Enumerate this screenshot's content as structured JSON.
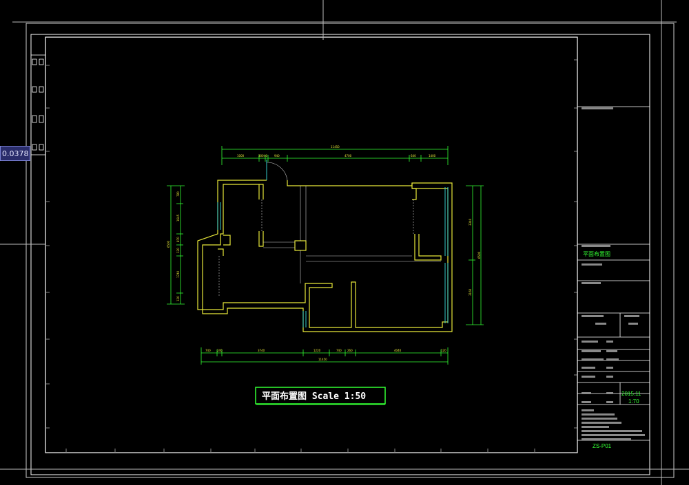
{
  "viewport": {
    "coordinate_readout": "0.0378"
  },
  "drawing": {
    "title_label": "平面布置图 Scale 1:50",
    "dimensions": {
      "top_total": "11450",
      "top_segments": [
        "1000",
        "300",
        "40",
        "940",
        "4700",
        "640",
        "1400"
      ],
      "bottom_total": "11450",
      "bottom_segments": [
        "740",
        "240",
        "3740",
        "1220",
        "740",
        "260",
        "4040",
        "120"
      ],
      "left_total": "6500",
      "left_segments": [
        "780",
        "1645",
        "870",
        "120",
        "1740",
        "120"
      ],
      "right_total": "6500",
      "right_segments": [
        "3340",
        "3160"
      ]
    }
  },
  "title_block": {
    "drawing_name": "平面布置图",
    "date": "2015.11",
    "scale": "1:70",
    "sheet_number": "ZS-P01"
  },
  "colors": {
    "background": "#000000",
    "frame": "#ffffff",
    "wall": "#e9e93a",
    "dimension": "#33ff33",
    "window": "#33cccc",
    "title_text": "#33ff33",
    "coord_box_bg": "#2a2d6b"
  }
}
